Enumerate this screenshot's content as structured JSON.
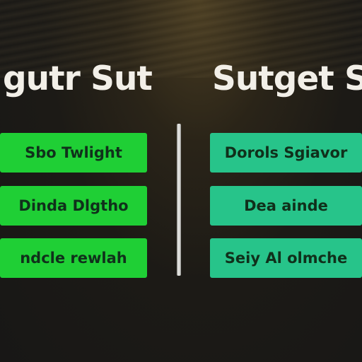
{
  "left_panel": {
    "title": "gutr Sut",
    "buttons": [
      "Sbo Twlight",
      "Dinda Dlgtho",
      "ndcle rewlah"
    ]
  },
  "right_panel": {
    "title": "Sutget S",
    "buttons": [
      "Dorols Sgiavor",
      "Dea ainde",
      "Seiy Al olmche"
    ]
  },
  "colors": {
    "left_button": "#1fcf35",
    "right_button": "#27c48a",
    "heading_text": "#f2efe8",
    "background": "#1c1a16"
  }
}
